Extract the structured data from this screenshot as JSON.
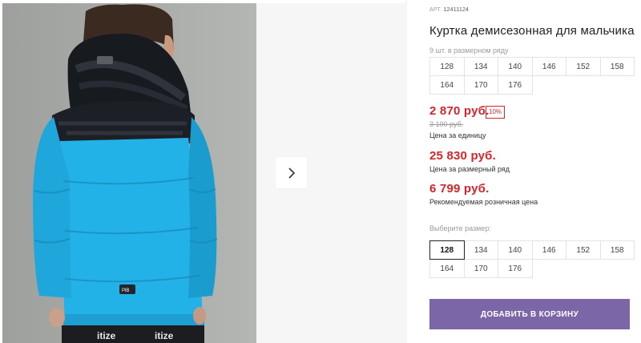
{
  "gallery": {
    "next_icon": "chevron-right-icon",
    "brand_mark": "PlB",
    "pants_print": [
      "itize",
      "itize"
    ]
  },
  "product": {
    "article_label": "АРТ.",
    "article_number": "12411124",
    "title": "Куртка демисезонная для мальчика",
    "row_note": "9 шт. в размерном ряду",
    "row_sizes": [
      "128",
      "134",
      "140",
      "146",
      "152",
      "158",
      "164",
      "170",
      "176"
    ],
    "price_unit": "2 870 руб.",
    "discount": "10%",
    "old_price": "3 190 руб.",
    "price_unit_caption": "Цена за единицу",
    "price_row": "25 830 руб.",
    "price_row_caption": "Цена за размерный ряд",
    "price_rrp": "6 799 руб.",
    "price_rrp_caption": "Рекомендуемая розничная цена",
    "choose_label": "Выберите размер:",
    "choose_sizes": [
      "128",
      "134",
      "140",
      "146",
      "152",
      "158",
      "164",
      "170",
      "176"
    ],
    "selected_size": "128",
    "add_to_cart": "ДОБАВИТЬ В КОРЗИНУ"
  },
  "colors": {
    "accent_button": "#7b66a8",
    "price_red": "#d4252b",
    "jacket_blue": "#23b2e8"
  }
}
